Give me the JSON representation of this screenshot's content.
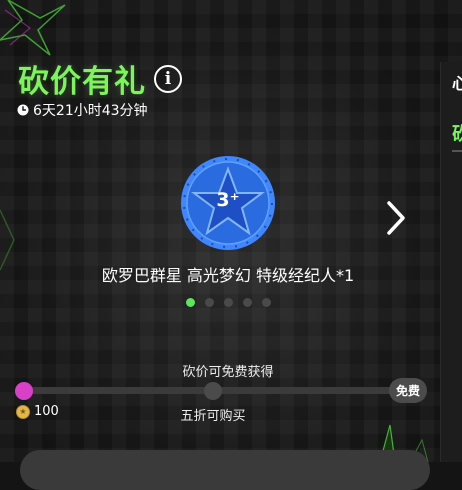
{
  "header": {
    "title": "砍价有礼",
    "info_symbol": "i",
    "countdown": "6天21小时43分钟"
  },
  "reward": {
    "badge_label": "3⁺",
    "name": "欧罗巴群星 高光梦幻 特级经纪人*1",
    "carousel_total": 5,
    "carousel_active": 0
  },
  "side_panel": {
    "text_top": "心",
    "text_green": "砍"
  },
  "progress": {
    "caption": "砍价可免费获得",
    "free_label": "免费",
    "price": "100",
    "half_price_label": "五折可购买",
    "value": 0.0
  },
  "colors": {
    "accent_green": "#7cf55a",
    "progress_pink": "#d940c8",
    "badge_blue": "#2b6be0"
  }
}
